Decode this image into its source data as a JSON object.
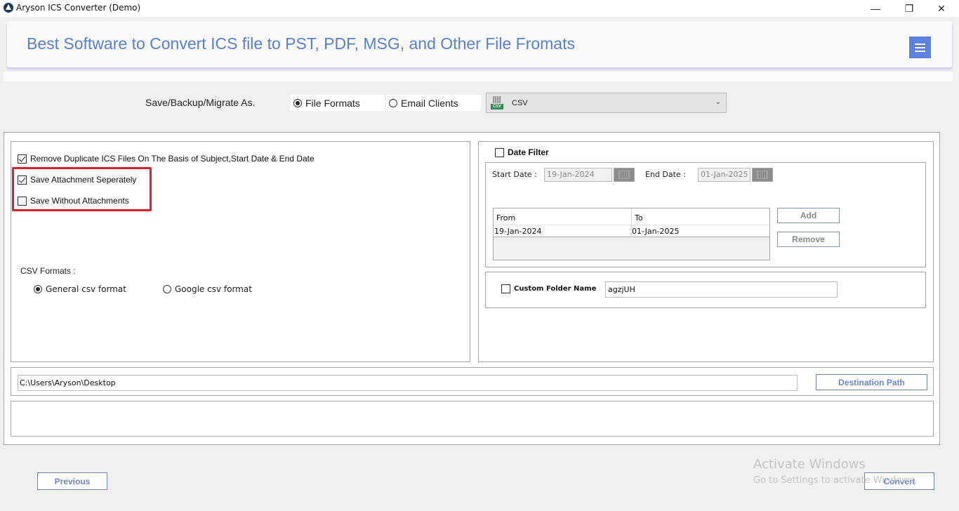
{
  "window": {
    "title": "Aryson ICS Converter (Demo)",
    "controls": {
      "minimize": "—",
      "maximize": "❐",
      "close": "✕"
    }
  },
  "banner": {
    "title": "Best Software to Convert ICS file to PST, PDF, MSG, and Other File Fromats",
    "menu_icon": "hamburger-icon",
    "accent_color": "#5b82e3"
  },
  "save_as": {
    "label": "Save/Backup/Migrate As.",
    "options": [
      {
        "label": "File Formats",
        "selected": true
      },
      {
        "label": "Email Clients",
        "selected": false
      }
    ],
    "format_select": {
      "value": "CSV",
      "icon": "csv-file-icon",
      "icon_tag": "CSV"
    }
  },
  "options": {
    "remove_duplicates": {
      "label": "Remove Duplicate ICS Files On The Basis of Subject,Start Date & End Date",
      "checked": true
    },
    "save_attachment_separately": {
      "label": "Save Attachment Seperately",
      "checked": true
    },
    "save_without_attachments": {
      "label": "Save Without Attachments",
      "checked": false
    },
    "highlight_color": "#d9232e"
  },
  "csv_formats": {
    "label": "CSV Formats :",
    "options": [
      {
        "label": "General csv format",
        "selected": true
      },
      {
        "label": "Google csv format",
        "selected": false
      }
    ]
  },
  "date_filter": {
    "label": "Date Filter",
    "checked": false,
    "start_label": "Start Date :",
    "start_value": "19-Jan-2024",
    "end_label": "End Date :",
    "end_value": "01-Jan-2025",
    "table": {
      "columns": [
        "From",
        "To"
      ],
      "rows": [
        [
          "19-Jan-2024",
          "01-Jan-2025"
        ]
      ]
    },
    "add_label": "Add",
    "remove_label": "Remove"
  },
  "custom_folder": {
    "label": "Custom Folder Name",
    "checked": false,
    "value": "agzjUH"
  },
  "destination": {
    "path": "C:\\Users\\Aryson\\Desktop",
    "button_label": "Destination Path"
  },
  "footer": {
    "previous_label": "Previous",
    "convert_label": "Convert"
  },
  "watermark": {
    "line1": "Activate Windows",
    "line2": "Go to Settings to activate Windows."
  }
}
